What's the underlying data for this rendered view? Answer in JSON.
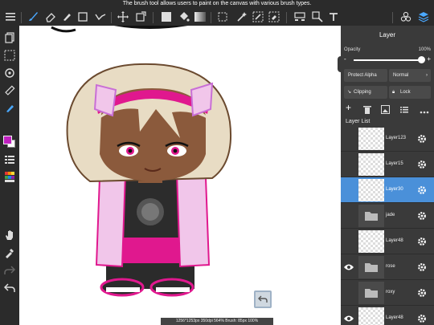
{
  "tip": "The brush tool allows users to paint on the canvas with various brush types.",
  "toolbar": {
    "items": [
      "menu-icon",
      "brush-icon",
      "eraser-icon",
      "smudge-icon",
      "shape-icon",
      "curve-icon",
      "move-icon",
      "transform-icon",
      "fill-color-icon",
      "bucket-icon",
      "gradient-icon",
      "select-rect-icon",
      "magic-wand-icon",
      "selection-pen-icon",
      "select-eraser-icon",
      "reference-icon",
      "copy-paste-icon",
      "text-icon",
      "materials-icon",
      "layers-icon"
    ]
  },
  "leftbar": {
    "items": [
      "pages-icon",
      "selection-icon",
      "rotate-icon",
      "ruler-icon",
      "fill-icon",
      "color-swatch",
      "layer-list-icon",
      "palette-icon",
      "hand-icon",
      "eyedropper-icon",
      "redo-icon",
      "undo-icon"
    ],
    "colors": {
      "primary": "#c020c0",
      "secondary": "#ffffff"
    }
  },
  "panel": {
    "title": "Layer",
    "opacity_label": "Opacity",
    "opacity_value": "100%",
    "opacity_fraction": 1.0,
    "minus": "-",
    "plus": "+",
    "protect_alpha": "Protect Alpha",
    "blend_mode": "Normal",
    "clipping": "Clipping",
    "lock": "Lock",
    "layer_list_label": "Layer List"
  },
  "layers": [
    {
      "name": "Layer123",
      "visible": false,
      "type": "thumb",
      "selected": false
    },
    {
      "name": "Layer15",
      "visible": false,
      "type": "thumb",
      "selected": false
    },
    {
      "name": "Layer30",
      "visible": false,
      "type": "thumb",
      "selected": true
    },
    {
      "name": "jade",
      "visible": false,
      "type": "folder",
      "selected": false
    },
    {
      "name": "Layer48",
      "visible": false,
      "type": "thumb",
      "selected": false
    },
    {
      "name": "rose",
      "visible": true,
      "type": "folder",
      "selected": false
    },
    {
      "name": "roxy",
      "visible": false,
      "type": "folder",
      "selected": false
    },
    {
      "name": "Layer48",
      "visible": true,
      "type": "thumb",
      "selected": false
    }
  ],
  "status": "1256*1253px 350dpi 564% Brush: 85px 100%",
  "accent": "#4a90d9"
}
